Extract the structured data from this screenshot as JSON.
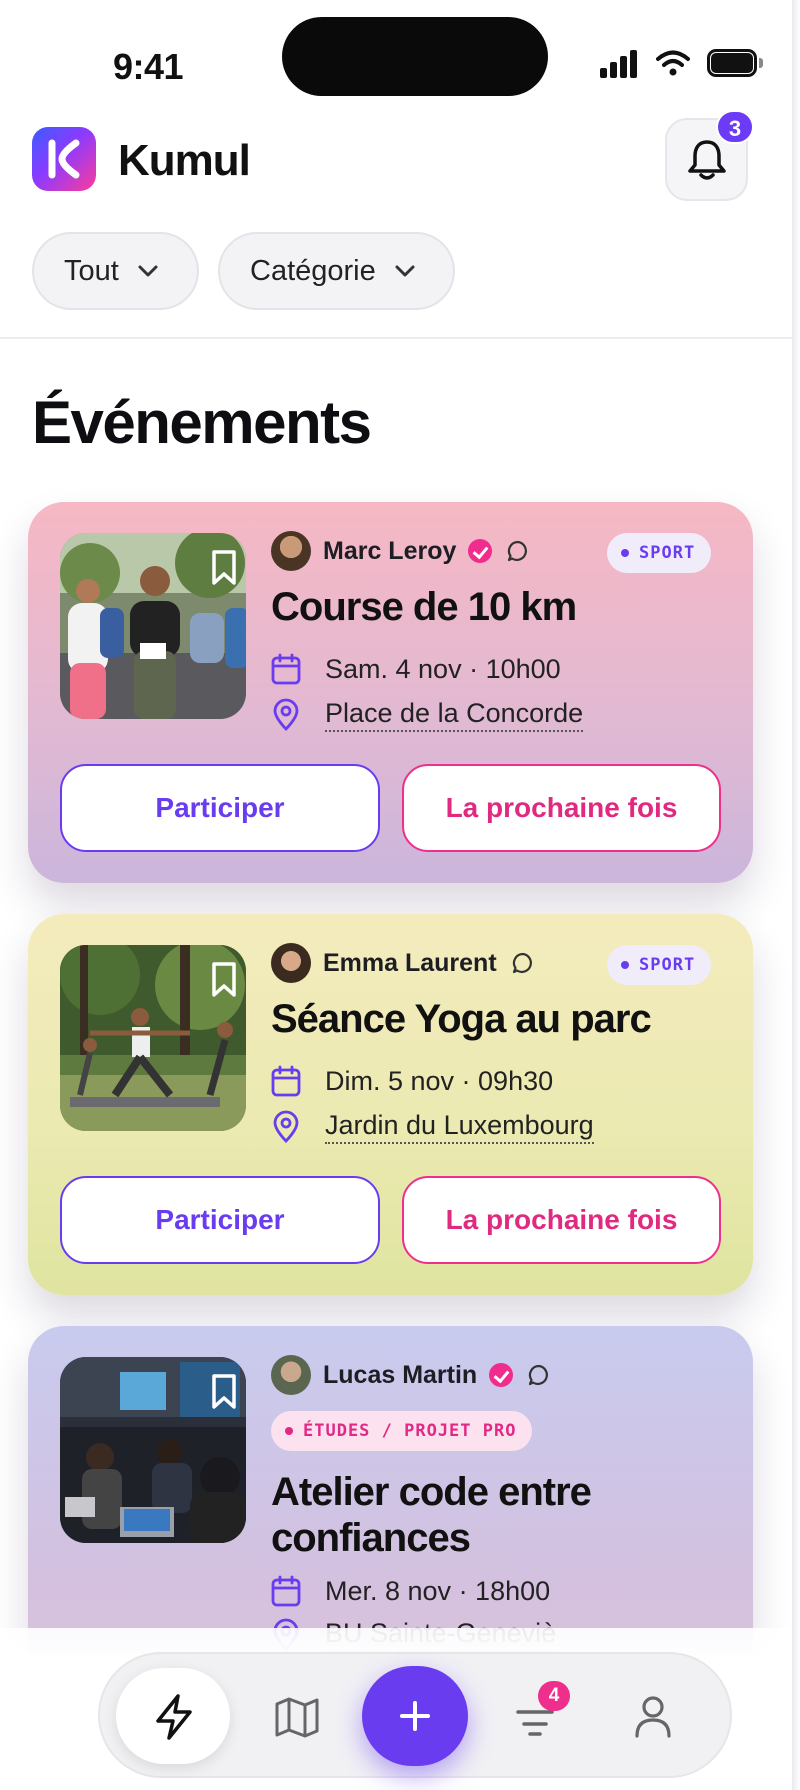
{
  "status_bar": {
    "time": "9:41"
  },
  "header": {
    "app_name": "Kumul",
    "notifications_count": "3"
  },
  "filters": [
    {
      "label": "Tout"
    },
    {
      "label": "Catégorie"
    }
  ],
  "section_title": "Événements",
  "events": [
    {
      "organizer": "Marc Leroy",
      "verified": true,
      "category": "SPORT",
      "title": "Course de 10 km",
      "date": "Sam. 4 nov · 10h00",
      "location": "Place de la Concorde",
      "participate_label": "Participer",
      "next_time_label": "La prochaine fois"
    },
    {
      "organizer": "Emma Laurent",
      "verified": false,
      "category": "SPORT",
      "title": "Séance Yoga au parc",
      "date": "Dim. 5 nov · 09h30",
      "location": "Jardin du Luxembourg",
      "participate_label": "Participer",
      "next_time_label": "La prochaine fois"
    },
    {
      "organizer": "Lucas Martin",
      "verified": true,
      "category": "ÉTUDES / PROJET PRO",
      "title": "Atelier code entre confiances",
      "date": "Mer. 8 nov · 18h00",
      "location": "BU Sainte-Geneviè"
    }
  ],
  "bottom_nav": {
    "items": [
      "bolt-icon",
      "map-icon",
      "add-icon",
      "filter-icon",
      "profile-icon"
    ],
    "filter_badge": "4"
  },
  "colors": {
    "accent": "#6a3cf0",
    "pink": "#ee2f8c"
  }
}
